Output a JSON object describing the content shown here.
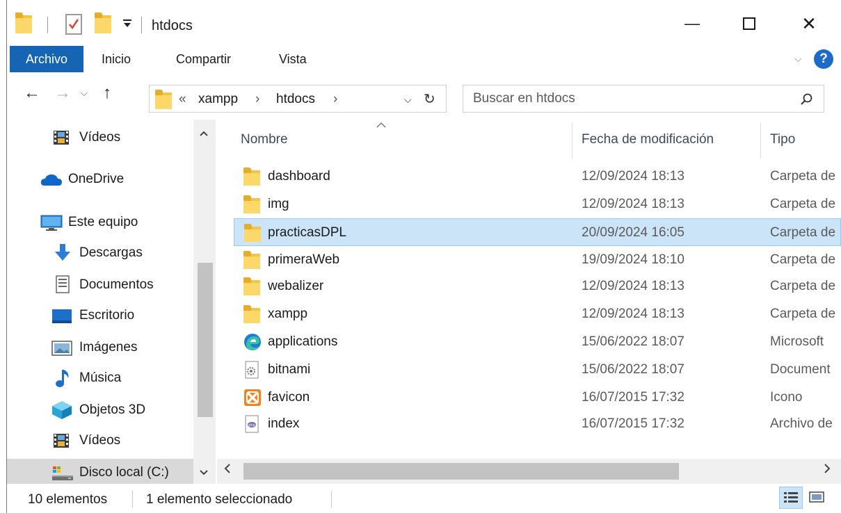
{
  "window": {
    "title": "htdocs",
    "minimize_glyph": "—",
    "maximize_glyph": "☐",
    "close_glyph": "✕"
  },
  "ribbon": {
    "tabs": [
      "Archivo",
      "Inicio",
      "Compartir",
      "Vista"
    ],
    "help_label": "?",
    "expand_glyph": "⌵"
  },
  "address": {
    "overflow": "«",
    "crumbs": [
      "xampp",
      "htdocs"
    ],
    "separator": "›",
    "dropdown_glyph": "⌵",
    "refresh_glyph": "↻"
  },
  "search": {
    "placeholder": "Buscar en htdocs",
    "icon": "search-icon"
  },
  "nav": {
    "back_glyph": "←",
    "forward_glyph": "→",
    "recent_glyph": "⌵",
    "up_glyph": "↑",
    "items": [
      {
        "label": "Vídeos",
        "icon": "videos-icon"
      },
      {
        "label": "OneDrive",
        "icon": "onedrive-icon"
      },
      {
        "label": "Este equipo",
        "icon": "this-pc-icon"
      },
      {
        "label": "Descargas",
        "icon": "downloads-icon"
      },
      {
        "label": "Documentos",
        "icon": "documents-icon"
      },
      {
        "label": "Escritorio",
        "icon": "desktop-icon"
      },
      {
        "label": "Imágenes",
        "icon": "pictures-icon"
      },
      {
        "label": "Música",
        "icon": "music-icon"
      },
      {
        "label": "Objetos 3D",
        "icon": "3d-objects-icon"
      },
      {
        "label": "Vídeos",
        "icon": "videos-icon"
      },
      {
        "label": "Disco local (C:)",
        "icon": "local-disk-icon"
      }
    ]
  },
  "columns": {
    "name": "Nombre",
    "date": "Fecha de modificación",
    "type": "Tipo"
  },
  "files": [
    {
      "name": "dashboard",
      "date": "12/09/2024 18:13",
      "type": "Carpeta de",
      "icon": "folder-icon"
    },
    {
      "name": "img",
      "date": "12/09/2024 18:13",
      "type": "Carpeta de",
      "icon": "folder-icon"
    },
    {
      "name": "practicasDPL",
      "date": "20/09/2024 16:05",
      "type": "Carpeta de",
      "icon": "folder-icon"
    },
    {
      "name": "primeraWeb",
      "date": "19/09/2024 18:10",
      "type": "Carpeta de",
      "icon": "folder-icon"
    },
    {
      "name": "webalizer",
      "date": "12/09/2024 18:13",
      "type": "Carpeta de",
      "icon": "folder-icon"
    },
    {
      "name": "xampp",
      "date": "12/09/2024 18:13",
      "type": "Carpeta de",
      "icon": "folder-icon"
    },
    {
      "name": "applications",
      "date": "15/06/2022 18:07",
      "type": "Microsoft",
      "icon": "edge-icon"
    },
    {
      "name": "bitnami",
      "date": "15/06/2022 18:07",
      "type": "Document",
      "icon": "css-file-icon"
    },
    {
      "name": "favicon",
      "date": "16/07/2015 17:32",
      "type": "Icono",
      "icon": "xampp-icon"
    },
    {
      "name": "index",
      "date": "16/07/2015 17:32",
      "type": "Archivo de",
      "icon": "php-file-icon"
    }
  ],
  "status": {
    "count": "10 elementos",
    "selection": "1 elemento seleccionado"
  },
  "colors": {
    "file_tab": "#1664b4",
    "selection_bg": "#cce4f7",
    "selection_border": "#99c9ef",
    "folder": "#fcd86a"
  }
}
